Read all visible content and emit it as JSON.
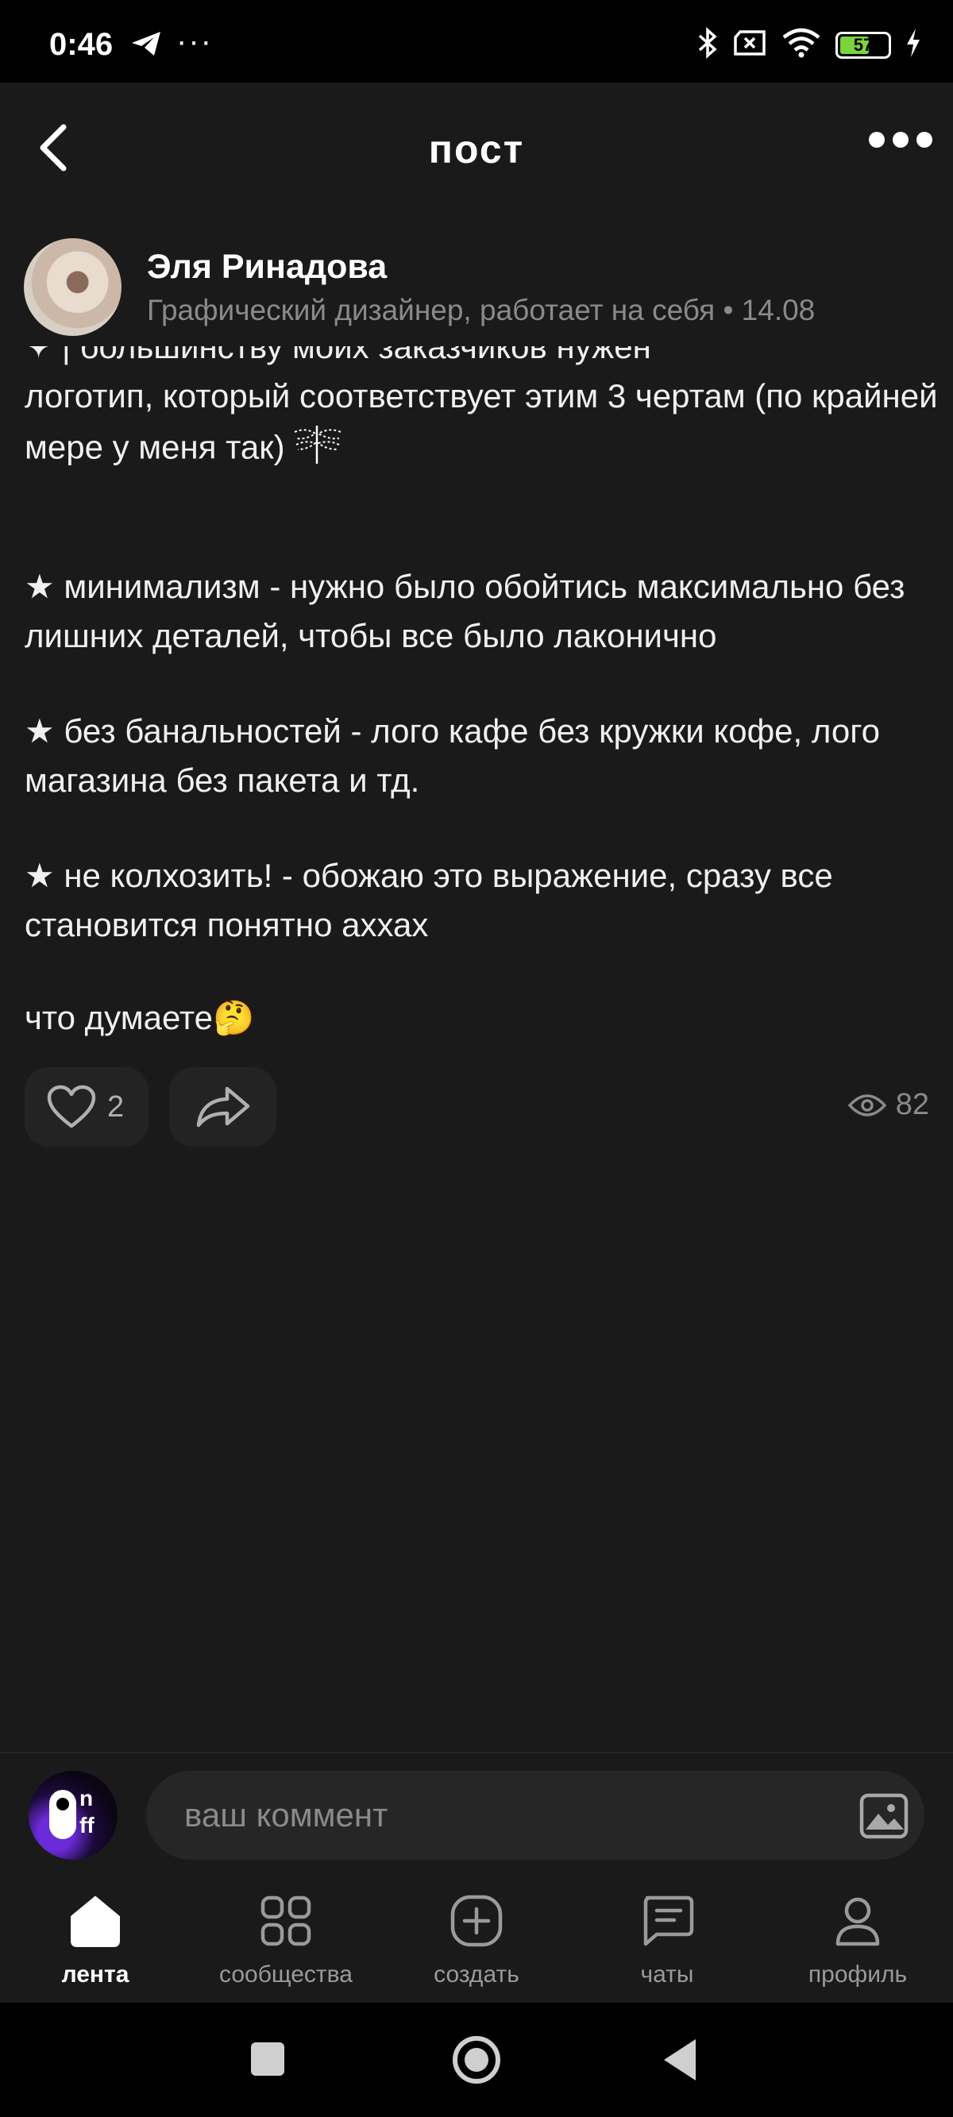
{
  "status_bar": {
    "time": "0:46",
    "more": "···",
    "battery": "57",
    "icons": [
      "telegram-icon",
      "bluetooth-icon",
      "sim-off-icon",
      "wifi-icon",
      "battery-icon",
      "charging-icon"
    ]
  },
  "header": {
    "title": "пост"
  },
  "author": {
    "name": "Эля Ринадова",
    "meta": "Графический дизайнер, работает на себя • 14.08"
  },
  "post": {
    "partial_line": "✦ |  большинству моих заказчиков нужен",
    "intro": "логотип, который соответствует этим 3 чертам (по крайней мере у меня так)",
    "point1": "★ минимализм - нужно было обойтись максимально без лишних деталей, чтобы все было лаконично",
    "point2": "★  без банальностей - лого кафе без кружки кофе, лого магазина без пакета и тд.",
    "point3": "★  не колхозить! - обожаю это выражение, сразу все становится понятно аххах",
    "closing": "что думаете🤔"
  },
  "actions": {
    "likes": "2",
    "views": "82"
  },
  "comment": {
    "placeholder": "ваш коммент",
    "avatar_text": "n\nff"
  },
  "nav": {
    "items": [
      {
        "label": "лента",
        "icon": "home-icon",
        "active": true
      },
      {
        "label": "сообщества",
        "icon": "grid-icon",
        "active": false
      },
      {
        "label": "создать",
        "icon": "plus-square-icon",
        "active": false
      },
      {
        "label": "чаты",
        "icon": "chat-icon",
        "active": false
      },
      {
        "label": "профиль",
        "icon": "profile-icon",
        "active": false
      }
    ]
  },
  "colors": {
    "background": "#1a1a1a",
    "accent_battery": "#7bd43b",
    "muted_text": "#8a8a8a"
  }
}
